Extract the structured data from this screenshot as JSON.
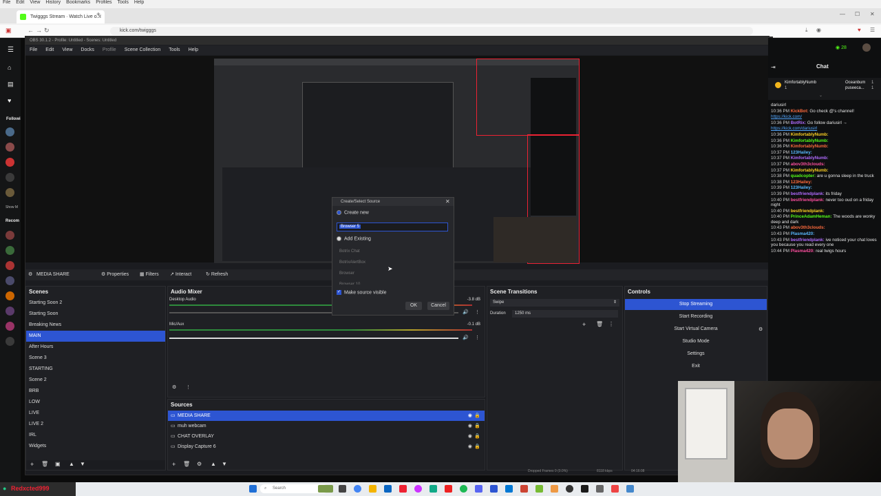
{
  "browser": {
    "menu": [
      "File",
      "Edit",
      "View",
      "History",
      "Bookmarks",
      "Profiles",
      "Tools",
      "Help"
    ],
    "tab_label": "Twigggs Stream · Watch Live o...",
    "url": "kick.com/twigggs"
  },
  "kick_nav": {
    "following": "Followi",
    "show_more": "Show M",
    "recommended": "Recom"
  },
  "obs": {
    "title": "OBS 30.1.2 - Profile: Untitled - Scenes: Untitled",
    "menu": [
      "File",
      "Edit",
      "View",
      "Docks",
      "Profile",
      "Scene Collection",
      "Tools",
      "Help"
    ],
    "selected_source_label": "MEDIA SHARE",
    "props_buttons": {
      "properties": "Properties",
      "filters": "Filters",
      "interact": "Interact",
      "refresh": "Refresh"
    },
    "scenes": {
      "title": "Scenes",
      "items": [
        "Starting Soon 2",
        "Starting Soon",
        "Breaking News",
        "MAIN",
        "After Hours",
        "Scene 3",
        "STARTING",
        "Scene 2",
        "BRB",
        "LOW",
        "LIVE",
        "LIVE 2",
        "IRL",
        "Widgets"
      ],
      "selected": "MAIN"
    },
    "audio_mixer": {
      "title": "Audio Mixer",
      "channels": [
        {
          "name": "Desktop Audio",
          "db": "-3.8 dB"
        },
        {
          "name": "Mic/Aux",
          "db": "-0.1 dB"
        }
      ],
      "scale": [
        "-60",
        "-55",
        "-50",
        "-45",
        "-40",
        "-35",
        "-30",
        "-25",
        "-20",
        "-15",
        "-10",
        "-5",
        "0"
      ]
    },
    "sources": {
      "title": "Sources",
      "items": [
        "MEDIA SHARE",
        "muh webcam",
        "CHAT OVERLAY",
        "Display Capture 6"
      ],
      "selected": "MEDIA SHARE"
    },
    "transitions": {
      "title": "Scene Transitions",
      "type": "Swipe",
      "duration_label": "Duration",
      "duration_value": "1250 ms"
    },
    "controls": {
      "title": "Controls",
      "buttons": [
        "Stop Streaming",
        "Start Recording",
        "Start Virtual Camera",
        "Studio Mode",
        "Settings",
        "Exit"
      ]
    },
    "status": {
      "dropped": "Dropped Frames 0 (0.0%)",
      "kbps": "8118 kbps",
      "time": "04:16:08"
    },
    "dialog": {
      "title": "Create/Select Source",
      "create_new": "Create new",
      "name_value": "Browser 5",
      "add_existing": "Add Existing",
      "existing": [
        "Botrix Chat",
        "BotrixAlertBox",
        "Browser",
        "Browser 10"
      ],
      "make_visible": "Make source visible",
      "ok": "OK",
      "cancel": "Cancel"
    }
  },
  "chat": {
    "title": "Chat",
    "viewers": "28",
    "pinned": [
      {
        "user": "KimfortablyNumb",
        "count": "1"
      },
      {
        "user": "Oceanbum",
        "count": "1"
      },
      {
        "user": "puseeca...",
        "count": "1"
      }
    ],
    "messages": [
      {
        "time": "",
        "user": "",
        "text": "dariusirl"
      },
      {
        "time": "10:36 PM",
        "user": "KickBot:",
        "text": "Go check @'s channel!"
      },
      {
        "time": "",
        "user": "",
        "text": "https://kick.com/",
        "link": true
      },
      {
        "time": "10:36 PM",
        "user": "BotRix:",
        "text": "Go follow dariusirl →"
      },
      {
        "time": "",
        "user": "",
        "text": "https://kick.com/dariusirl",
        "link": true
      },
      {
        "time": "10:36 PM",
        "user": "KimfortablyNumb:",
        "text": ""
      },
      {
        "time": "10:36 PM",
        "user": "KimfortablyNumb:",
        "text": ""
      },
      {
        "time": "10:36 PM",
        "user": "KimfortablyNumb:",
        "text": ""
      },
      {
        "time": "10:37 PM",
        "user": "123Hailey:",
        "text": ""
      },
      {
        "time": "10:37 PM",
        "user": "KimfortablyNumb:",
        "text": ""
      },
      {
        "time": "10:37 PM",
        "user": "abov3th3clouds:",
        "text": ""
      },
      {
        "time": "10:37 PM",
        "user": "KimfortablyNumb:",
        "text": ""
      },
      {
        "time": "10:38 PM",
        "user": "quadcopter:",
        "text": "are u gonna sleep in the truck"
      },
      {
        "time": "10:38 PM",
        "user": "123Hailey:",
        "text": ""
      },
      {
        "time": "10:39 PM",
        "user": "123Hailey:",
        "text": ""
      },
      {
        "time": "10:39 PM",
        "user": "bestfriendplank:",
        "text": "its friday"
      },
      {
        "time": "10:40 PM",
        "user": "bestfriendplank:",
        "text": "never too oud on a friday night"
      },
      {
        "time": "10:40 PM",
        "user": "bestfriendplank:",
        "text": ""
      },
      {
        "time": "10:40 PM",
        "user": "PrinceAdamHeman:",
        "text": "The woods are wonky deep and dark"
      },
      {
        "time": "10:43 PM",
        "user": "abov3th3clouds:",
        "text": ""
      },
      {
        "time": "10:43 PM",
        "user": "Plasma420:",
        "text": ""
      },
      {
        "time": "10:43 PM",
        "user": "bestfriendplank:",
        "text": "ive noticed your chat loves you because you read every one"
      },
      {
        "time": "10:44 PM",
        "user": "Plasma420:",
        "text": "real twigs hours"
      }
    ]
  },
  "taskbar": {
    "user": "Redxcted999",
    "search": "Search"
  },
  "colors": {
    "accent": "#2d55d2",
    "kick_green": "#53fc18"
  }
}
